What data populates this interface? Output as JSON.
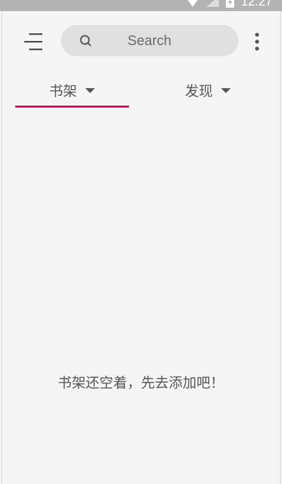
{
  "status_bar": {
    "time": "12:27",
    "icons": [
      "wifi-icon",
      "signal-icon",
      "battery-icon"
    ]
  },
  "toolbar": {
    "menu_icon": "menu-icon",
    "search_placeholder": "Search",
    "search_icon": "search-icon",
    "overflow_icon": "more-vert-icon"
  },
  "tabs": [
    {
      "label": "书架",
      "selected": true
    },
    {
      "label": "发现",
      "selected": false
    }
  ],
  "main": {
    "empty_message": "书架还空着，先去添加吧！"
  },
  "colors": {
    "accent": "#c2185b",
    "background": "#f5f5f5",
    "search_background": "#e0e0e0",
    "status_bar": "#b3b3b3"
  }
}
